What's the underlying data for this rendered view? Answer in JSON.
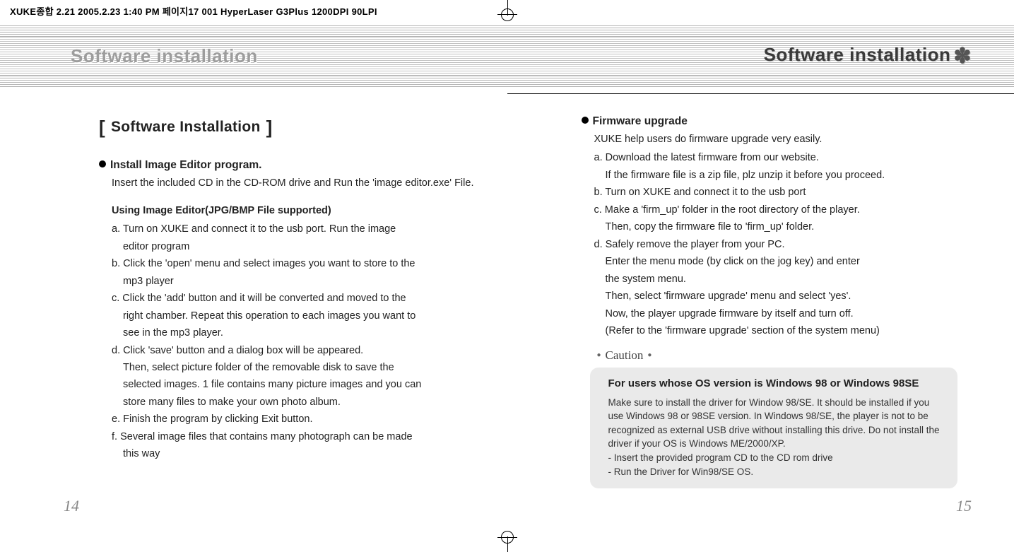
{
  "imprint": "XUKE종합 2.21  2005.2.23 1:40 PM  페이지17   001 HyperLaser G3Plus 1200DPI 90LPI",
  "header": {
    "left": "Software installation",
    "right": "Software installation",
    "star": "✽"
  },
  "left_page": {
    "section_title": "Software Installation",
    "h1": "Install Image Editor program.",
    "p1": "Insert the included CD in the CD-ROM drive and Run the 'image editor.exe' File.",
    "h2": "Using Image Editor(JPG/BMP File supported)",
    "a": "a. Turn on XUKE and connect it to the usb port. Run the image",
    "a2": "editor program",
    "b": "b. Click the 'open' menu and select images you want to store to the",
    "b2": "mp3 player",
    "c": "c. Click the 'add' button and it will be converted and moved to the",
    "c2": "right chamber. Repeat this operation to each images you want to",
    "c3": "see in the mp3 player.",
    "d": "d. Click 'save' button and a dialog box will be appeared.",
    "d2": "Then, select picture folder of the removable disk to save the",
    "d3": "selected images. 1 file contains many picture images and you can",
    "d4": "store many files to make your own photo album.",
    "e": "e. Finish the program by clicking Exit button.",
    "f": "f. Several image files that contains many photograph can be made",
    "f2": "this way",
    "page_num": "14"
  },
  "right_page": {
    "h1": "Firmware upgrade",
    "p1": "XUKE help users do firmware upgrade very easily.",
    "a": "a.  Download the latest firmware from our website.",
    "a2": "If the firmware file is a zip file, plz unzip it before you proceed.",
    "b": "b. Turn on XUKE and connect it to the usb port",
    "c": "c. Make a 'firm_up' folder in the root directory of the player.",
    "c2": "Then, copy the firmware file to 'firm_up' folder.",
    "d": "d. Safely remove the player from your PC.",
    "d2": "Enter the menu mode (by click on the jog key) and enter",
    "d3": "the system menu.",
    "d4": "Then, select 'firmware upgrade' menu and select 'yes'.",
    "d5": "Now, the player upgrade firmware by itself and turn off.",
    "d6": "(Refer to the 'firmware upgrade' section of the system menu)",
    "caution_label": "Caution",
    "caution_title": "For users whose OS version is Windows 98 or Windows 98SE",
    "caution_body": "Make sure to install the driver for Window 98/SE. It should be installed if you use Windows 98 or 98SE version. In Windows 98/SE, the player is not to be recognized as external USB drive without installing this drive. Do not install the driver if your OS is Windows ME/2000/XP.",
    "caution_l1": "- Insert the provided program CD to the CD rom drive",
    "caution_l2": "- Run the Driver for Win98/SE OS.",
    "page_num": "15"
  }
}
